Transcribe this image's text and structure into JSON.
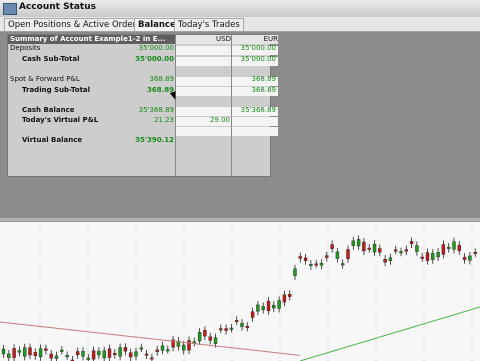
{
  "window": {
    "title": "Account Status"
  },
  "tabs": [
    {
      "label": "Open Positions & Active Orders"
    },
    {
      "label": "Balances"
    },
    {
      "label": "Today's Trades"
    }
  ],
  "table": {
    "summary_label": "Summary of Account Example1-2 in E...",
    "col_usd": "USD",
    "col_eur": "EUR",
    "rows": [
      {
        "label": "Deposits",
        "value": "35'000.00",
        "usd": "",
        "eur": "35'000.00"
      },
      {
        "label": "Cash Sub-Total",
        "value": "35'000.00",
        "usd": "",
        "eur": "35'000.00"
      },
      {
        "label": "Spot & Forward P&L",
        "value": "368.89",
        "usd": "",
        "eur": "368.89"
      },
      {
        "label": "Trading Sub-Total",
        "value": "368.89",
        "usd": "",
        "eur": "368.89"
      },
      {
        "label": "Cash Balance",
        "value": "35'368.89",
        "usd": "",
        "eur": "35'368.89"
      },
      {
        "label": "Today's Virtual P&L",
        "value": "21.23",
        "usd": "29.00",
        "eur": ""
      },
      {
        "label": "Virtual Balance",
        "value": "35'390.12",
        "usd": "",
        "eur": ""
      }
    ]
  },
  "chart": {
    "up_color": "#1f9a1f",
    "down_color": "#c41a1a",
    "ma_red_color": "#c67c7c",
    "ma_green_color": "#53b453"
  }
}
